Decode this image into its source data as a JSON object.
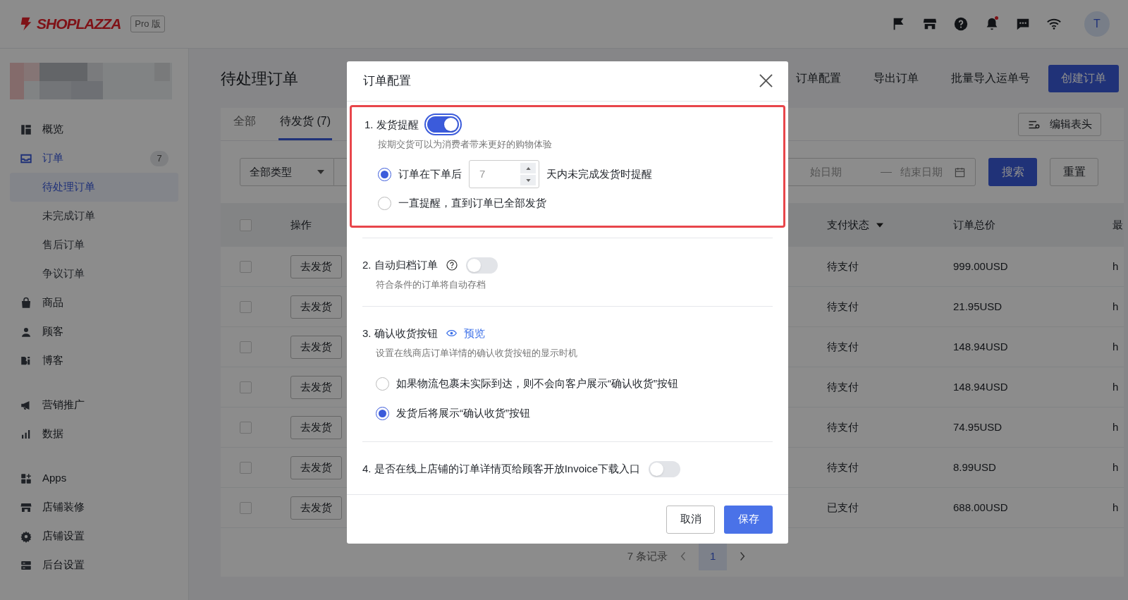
{
  "header": {
    "logo": "SHOPLAZZA",
    "edition": "Pro 版",
    "notification_dot": true,
    "avatar": "T"
  },
  "sidebar": {
    "items": [
      {
        "label": "概览",
        "selected": false
      },
      {
        "label": "订单",
        "selected": true,
        "badge": "7",
        "children": [
          {
            "label": "待处理订单",
            "selected": true
          },
          {
            "label": "未完成订单",
            "selected": false
          },
          {
            "label": "售后订单",
            "selected": false
          },
          {
            "label": "争议订单",
            "selected": false
          }
        ]
      },
      {
        "label": "商品",
        "selected": false
      },
      {
        "label": "顾客",
        "selected": false
      },
      {
        "label": "博客",
        "selected": false
      },
      {
        "label": "营销推广",
        "selected": false
      },
      {
        "label": "数据",
        "selected": false
      },
      {
        "label": "Apps",
        "selected": false
      },
      {
        "label": "店铺装修",
        "selected": false
      },
      {
        "label": "店铺设置",
        "selected": false
      },
      {
        "label": "后台设置",
        "selected": false
      }
    ]
  },
  "page": {
    "title": "待处理订单",
    "actions": [
      {
        "label": "订单配置",
        "kind": "link"
      },
      {
        "label": "导出订单",
        "kind": "link"
      },
      {
        "label": "批量导入运单号",
        "kind": "link"
      },
      {
        "label": "创建订单",
        "kind": "primary"
      }
    ],
    "tabs": [
      {
        "label": "全部",
        "selected": false
      },
      {
        "label": "待发货 (7)",
        "selected": true
      }
    ],
    "edit_columns_button": "编辑表头",
    "filters": {
      "type_select": "全部类型",
      "date_start_placeholder": "始日期",
      "date_end_placeholder": "结束日期",
      "search_button": "搜索",
      "reset_button": "重置"
    },
    "table": {
      "all_checked": false,
      "columns": [
        "操作",
        "支付状态",
        "订单总价",
        "最"
      ],
      "rows": [
        {
          "checked": false,
          "action": "去发货",
          "payment_status": "待支付",
          "total": "999.00USD",
          "column_6": "h"
        },
        {
          "checked": false,
          "action": "去发货",
          "payment_status": "待支付",
          "total": "21.95USD",
          "column_6": "h"
        },
        {
          "checked": false,
          "action": "去发货",
          "payment_status": "待支付",
          "total": "148.94USD",
          "column_6": "h"
        },
        {
          "checked": false,
          "action": "去发货",
          "payment_status": "待支付",
          "total": "148.94USD",
          "column_6": "h"
        },
        {
          "checked": false,
          "action": "去发货",
          "payment_status": "待支付",
          "total": "74.95USD",
          "column_6": "h"
        },
        {
          "checked": false,
          "action": "去发货",
          "payment_status": "待支付",
          "total": "8.99USD",
          "column_6": "h"
        },
        {
          "checked": false,
          "action": "去发货",
          "payment_status": "已支付",
          "total": "688.00USD",
          "column_6": "h"
        }
      ]
    },
    "pagination": {
      "summary": "7 条记录",
      "pages": [
        {
          "label": "1",
          "selected": true
        }
      ]
    }
  },
  "modal": {
    "title": "订单配置",
    "sections": [
      {
        "title": "1. 发货提醒",
        "toggle_on": true,
        "highlighted": true,
        "description": "按期交货可以为消费者带来更好的购物体验",
        "options": [
          {
            "kind": "days",
            "label_before": "订单在下单后",
            "value": "7",
            "label_after": "天内未完成发货时提醒",
            "selected": true
          },
          {
            "kind": "text",
            "label": "一直提醒，直到订单已全部发货",
            "selected": false
          }
        ]
      },
      {
        "title": "2. 自动归档订单",
        "help": true,
        "toggle_on": false,
        "highlighted": false,
        "description": "符合条件的订单将自动存档"
      },
      {
        "title": "3. 确认收货按钮",
        "preview_link": "预览",
        "highlighted": false,
        "description": "设置在线商店订单详情的确认收货按钮的显示时机",
        "options": [
          {
            "kind": "text",
            "label": "如果物流包裹未实际到达，则不会向客户展示“确认收货”按钮",
            "selected": false
          },
          {
            "kind": "text",
            "label": "发货后将展示“确认收货”按钮",
            "selected": true
          }
        ]
      },
      {
        "title": "4. 是否在线上店铺的订单详情页给顾客开放Invoice下载入口",
        "toggle_on": false,
        "highlighted": false
      }
    ],
    "cancel_button": "取消",
    "save_button": "保存"
  }
}
